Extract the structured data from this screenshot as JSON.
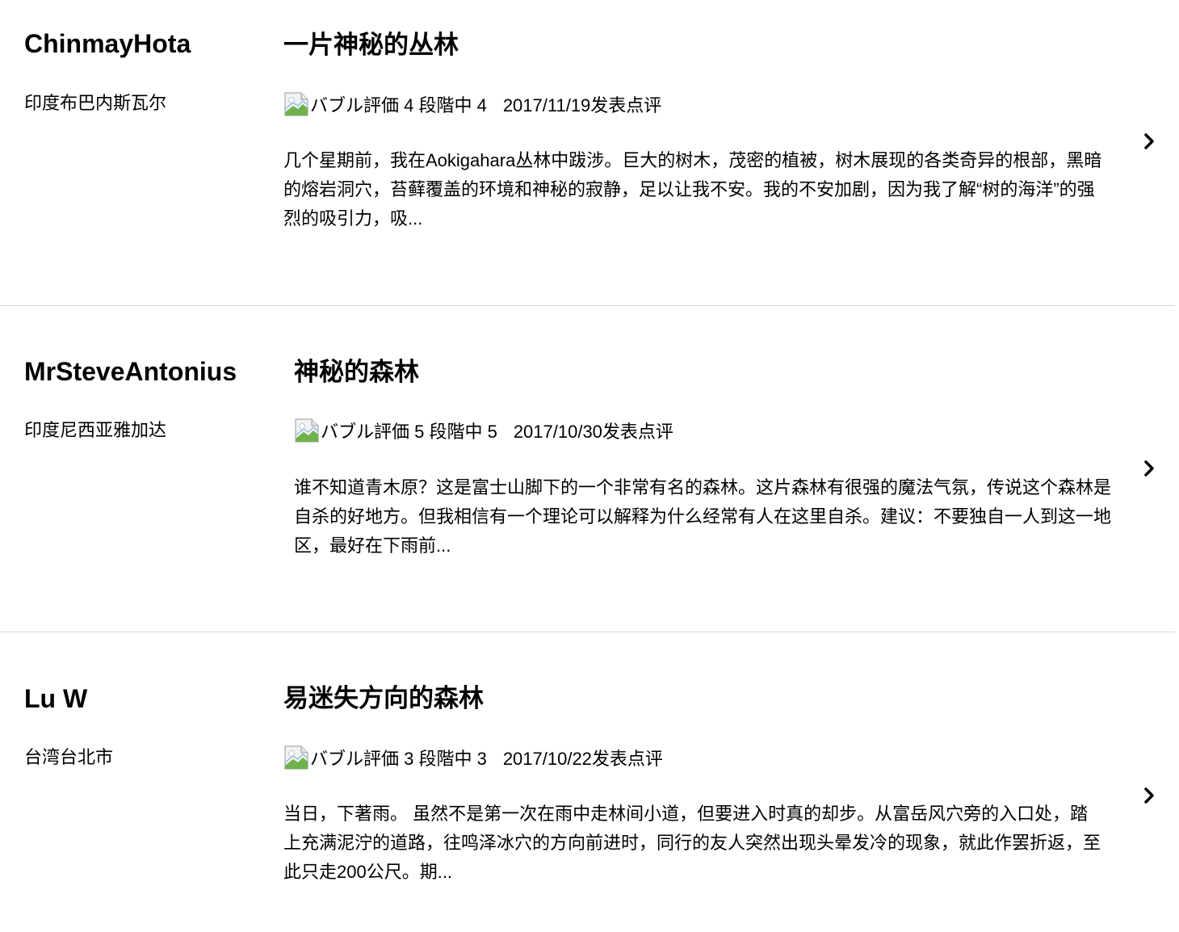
{
  "reviews": [
    {
      "user": "ChinmayHota",
      "location": "印度布巴内斯瓦尔",
      "title": "一片神秘的丛林",
      "rating_alt": "バブル評価 4 段階中 4",
      "date": "2017/11/19发表点评",
      "body": "几个星期前，我在Aokigahara丛林中跋涉。巨大的树木，茂密的植被，树木展现的各类奇异的根部，黑暗的熔岩洞穴，苔藓覆盖的环境和神秘的寂静，足以让我不安。我的不安加剧，因为我了解“树的海洋”的强烈的吸引力，吸..."
    },
    {
      "user": "MrSteveAntonius",
      "location": "印度尼西亚雅加达",
      "title": "神秘的森林",
      "rating_alt": "バブル評価 5 段階中 5",
      "date": "2017/10/30发表点评",
      "body": "谁不知道青木原？这是富士山脚下的一个非常有名的森林。这片森林有很强的魔法气氛，传说这个森林是自杀的好地方。但我相信有一个理论可以解释为什么经常有人在这里自杀。建议：不要独自一人到这一地区，最好在下雨前..."
    },
    {
      "user": "Lu W",
      "location": "台湾台北市",
      "title": "易迷失方向的森林",
      "rating_alt": "バブル評価 3 段階中 3",
      "date": "2017/10/22发表点评",
      "body": "当日，下著雨。 虽然不是第一次在雨中走林间小道，但要进入时真的却步。从富岳风穴旁的入口处，踏上充满泥泞的道路，往鸣泽冰穴的方向前进时，同行的友人突然出现头晕发冷的现象，就此作罢折返，至此只走200公尺。期..."
    }
  ],
  "icons": {
    "broken_image": "broken-image-icon",
    "chevron": "chevron-right-icon"
  },
  "colors": {
    "divider": "#d6d6d6",
    "text": "#000000"
  }
}
